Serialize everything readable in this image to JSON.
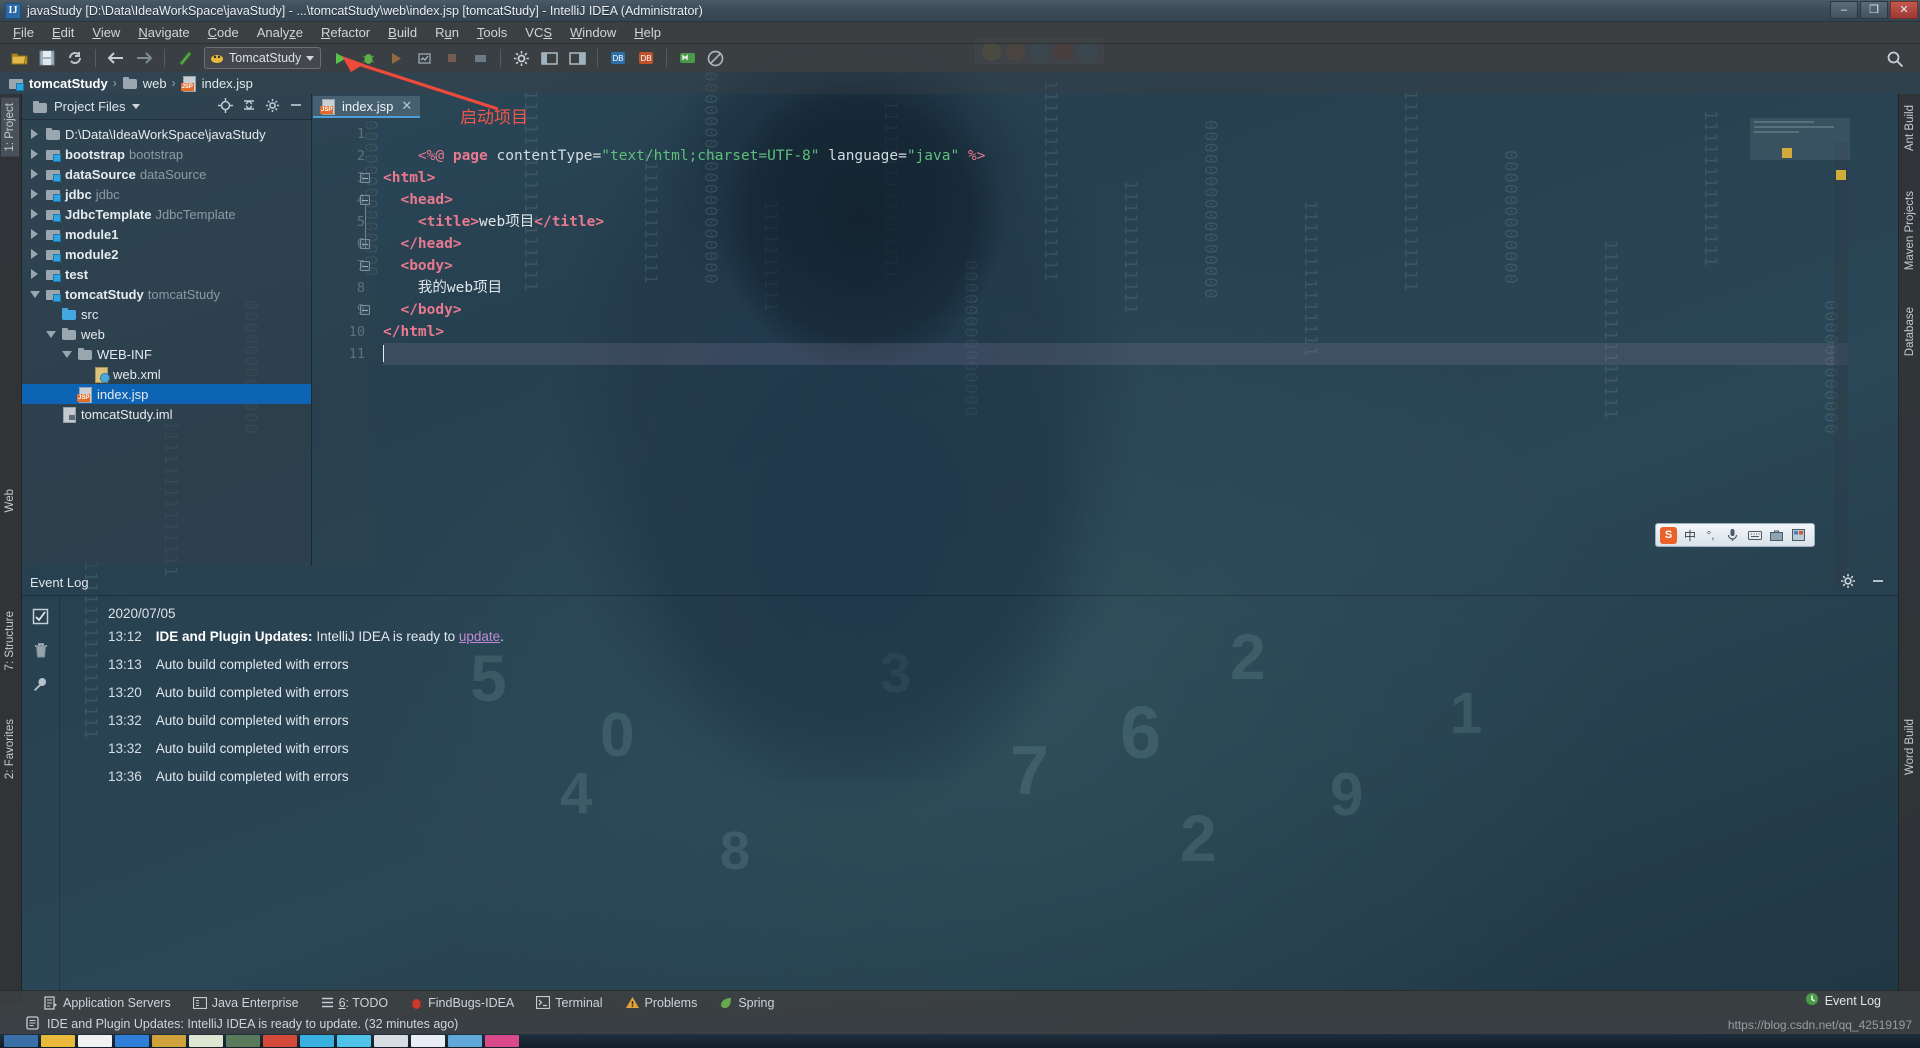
{
  "window": {
    "title": "javaStudy [D:\\Data\\IdeaWorkSpace\\javaStudy] - ...\\tomcatStudy\\web\\index.jsp [tomcatStudy] - IntelliJ IDEA (Administrator)",
    "app_icon": "IJ",
    "minimize_label": "–",
    "maximize_label": "❐",
    "close_label": "✕"
  },
  "menubar": {
    "items": [
      {
        "label": "File",
        "mnemonic": "F"
      },
      {
        "label": "Edit",
        "mnemonic": "E"
      },
      {
        "label": "View",
        "mnemonic": "V"
      },
      {
        "label": "Navigate",
        "mnemonic": "N"
      },
      {
        "label": "Code",
        "mnemonic": "C"
      },
      {
        "label": "Analyze",
        "mnemonic": "z"
      },
      {
        "label": "Refactor",
        "mnemonic": "R"
      },
      {
        "label": "Build",
        "mnemonic": "B"
      },
      {
        "label": "Run",
        "mnemonic": "u"
      },
      {
        "label": "Tools",
        "mnemonic": "T"
      },
      {
        "label": "VCS",
        "mnemonic": "S"
      },
      {
        "label": "Window",
        "mnemonic": "W"
      },
      {
        "label": "Help",
        "mnemonic": "H"
      }
    ]
  },
  "toolbar": {
    "open_icon": "open-folder-icon",
    "save_icon": "save-icon",
    "sync_icon": "sync-icon",
    "back_icon": "back-arrow-icon",
    "forward_icon": "forward-arrow-icon",
    "compile_icon": "compile-icon",
    "run_config_name": "TomcatStudy",
    "run_icon": "run-icon",
    "debug_icon": "debug-icon",
    "coverage_icon": "run-with-coverage-icon",
    "profile_icon": "profile-icon",
    "stop_icon": "stop-icon",
    "update_app_icon": "update-application-icon",
    "settings_icon": "settings-gear-icon",
    "project-structure_icon": "project-structure-icon",
    "modules_icon": "modules-icon",
    "db_icon": "database-icon",
    "db2_icon": "database-sync-icon",
    "search_everywhere_icon": "search-icon"
  },
  "navbar": {
    "crumbs": [
      {
        "label": "tomcatStudy",
        "icon": "module-icon",
        "bold": true
      },
      {
        "label": "web",
        "icon": "folder-icon",
        "bold": false
      },
      {
        "label": "index.jsp",
        "icon": "jsp-file-icon",
        "bold": false
      }
    ],
    "separator": "›"
  },
  "left_strip": {
    "tabs": [
      {
        "label": "1: Project",
        "active": true
      },
      {
        "label": "Web",
        "active": false
      },
      {
        "label": "7: Structure",
        "active": false
      },
      {
        "label": "2: Favorites",
        "active": false
      }
    ]
  },
  "right_strip": {
    "tabs": [
      {
        "label": "Ant Build"
      },
      {
        "label": "Maven Projects"
      },
      {
        "label": "Database"
      },
      {
        "label": "Word Build"
      }
    ]
  },
  "project_panel": {
    "title": "Project Files",
    "dropdown_icon": "chevron-down-icon",
    "actions": [
      {
        "name": "locate-icon",
        "glyph": "⊕"
      },
      {
        "name": "collapse-all-icon",
        "glyph": "↥"
      },
      {
        "name": "settings-gear-icon",
        "glyph": "⚙"
      },
      {
        "name": "hide-panel-icon",
        "glyph": "—"
      }
    ],
    "tree": [
      {
        "label": "D:\\Data\\IdeaWorkSpace\\javaStudy",
        "sub": "",
        "indent": 0,
        "twisty": "right",
        "icon": "folder",
        "bold": false,
        "selected": false
      },
      {
        "label": "bootstrap",
        "sub": "bootstrap",
        "indent": 0,
        "twisty": "right",
        "icon": "module",
        "bold": true,
        "selected": false
      },
      {
        "label": "dataSource",
        "sub": "dataSource",
        "indent": 0,
        "twisty": "right",
        "icon": "module",
        "bold": true,
        "selected": false
      },
      {
        "label": "jdbc",
        "sub": "jdbc",
        "indent": 0,
        "twisty": "right",
        "icon": "module",
        "bold": true,
        "selected": false
      },
      {
        "label": "JdbcTemplate",
        "sub": "JdbcTemplate",
        "indent": 0,
        "twisty": "right",
        "icon": "module",
        "bold": true,
        "selected": false
      },
      {
        "label": "module1",
        "sub": "",
        "indent": 0,
        "twisty": "right",
        "icon": "module",
        "bold": true,
        "selected": false
      },
      {
        "label": "module2",
        "sub": "",
        "indent": 0,
        "twisty": "right",
        "icon": "module",
        "bold": true,
        "selected": false
      },
      {
        "label": "test",
        "sub": "",
        "indent": 0,
        "twisty": "right",
        "icon": "module",
        "bold": true,
        "selected": false
      },
      {
        "label": "tomcatStudy",
        "sub": "tomcatStudy",
        "indent": 0,
        "twisty": "down",
        "icon": "module",
        "bold": true,
        "selected": false
      },
      {
        "label": "src",
        "sub": "",
        "indent": 1,
        "twisty": "none",
        "icon": "folder-blue",
        "bold": false,
        "selected": false
      },
      {
        "label": "web",
        "sub": "",
        "indent": 1,
        "twisty": "down",
        "icon": "folder",
        "bold": false,
        "selected": false
      },
      {
        "label": "WEB-INF",
        "sub": "",
        "indent": 2,
        "twisty": "down",
        "icon": "folder",
        "bold": false,
        "selected": false
      },
      {
        "label": "web.xml",
        "sub": "",
        "indent": 3,
        "twisty": "none",
        "icon": "xml",
        "bold": false,
        "selected": false
      },
      {
        "label": "index.jsp",
        "sub": "",
        "indent": 2,
        "twisty": "none",
        "icon": "jsp",
        "bold": false,
        "selected": true
      },
      {
        "label": "tomcatStudy.iml",
        "sub": "",
        "indent": 1,
        "twisty": "none",
        "icon": "iml",
        "bold": false,
        "selected": false
      }
    ]
  },
  "editor": {
    "tab": {
      "label": "index.jsp",
      "icon": "jsp-file-icon",
      "close_glyph": "✕"
    },
    "lines": [
      {
        "num": "1",
        "segments": [],
        "current": false
      },
      {
        "num": "2",
        "segments": [
          {
            "t": "    ",
            "c": "k-plain"
          },
          {
            "t": "<%@ ",
            "c": "k-dir"
          },
          {
            "t": "page",
            "c": "k-bold"
          },
          {
            "t": " contentType=",
            "c": "k-attr"
          },
          {
            "t": "\"text/html;charset=UTF-8\"",
            "c": "k-str"
          },
          {
            "t": " language=",
            "c": "k-attr"
          },
          {
            "t": "\"java\"",
            "c": "k-str"
          },
          {
            "t": " %>",
            "c": "k-dir"
          }
        ],
        "current": false
      },
      {
        "num": "3",
        "segments": [
          {
            "t": "<html>",
            "c": "k-tag"
          }
        ],
        "current": false
      },
      {
        "num": "4",
        "segments": [
          {
            "t": "  ",
            "c": "k-plain"
          },
          {
            "t": "<head>",
            "c": "k-tag"
          }
        ],
        "current": false
      },
      {
        "num": "5",
        "segments": [
          {
            "t": "    ",
            "c": "k-plain"
          },
          {
            "t": "<title>",
            "c": "k-tag"
          },
          {
            "t": "web项目",
            "c": "k-txt"
          },
          {
            "t": "</title>",
            "c": "k-tag"
          }
        ],
        "current": false
      },
      {
        "num": "6",
        "segments": [
          {
            "t": "  ",
            "c": "k-plain"
          },
          {
            "t": "</head>",
            "c": "k-tag"
          }
        ],
        "current": false
      },
      {
        "num": "7",
        "segments": [
          {
            "t": "  ",
            "c": "k-plain"
          },
          {
            "t": "<body>",
            "c": "k-tag"
          }
        ],
        "current": false
      },
      {
        "num": "8",
        "segments": [
          {
            "t": "    ",
            "c": "k-plain"
          },
          {
            "t": "我的web项目",
            "c": "k-txt"
          }
        ],
        "current": false
      },
      {
        "num": "9",
        "segments": [
          {
            "t": "  ",
            "c": "k-plain"
          },
          {
            "t": "</body>",
            "c": "k-tag"
          }
        ],
        "current": false
      },
      {
        "num": "10",
        "segments": [
          {
            "t": "</html>",
            "c": "k-tag"
          }
        ],
        "current": false
      },
      {
        "num": "11",
        "segments": [],
        "current": true,
        "caret": true
      }
    ]
  },
  "annotation": {
    "text": "启动项目",
    "color": "#f0564a",
    "arrow_name": "red-annotation-arrow"
  },
  "browser_popup": {
    "browsers": [
      {
        "name": "chrome-icon",
        "color": "#f2c14b"
      },
      {
        "name": "firefox-icon",
        "color": "#f08a24"
      },
      {
        "name": "edge-legacy-icon",
        "color": "#2e9fe0"
      },
      {
        "name": "opera-icon",
        "color": "#e0352b"
      },
      {
        "name": "ie-icon",
        "color": "#2e9fe0"
      }
    ]
  },
  "event_log": {
    "title": "Event Log",
    "actions": [
      {
        "name": "settings-gear-icon",
        "glyph": "⚙"
      },
      {
        "name": "hide-panel-icon",
        "glyph": "—"
      }
    ],
    "gutter_icons": [
      {
        "name": "mark-all-read-icon",
        "glyph": "☑"
      },
      {
        "name": "clear-all-icon",
        "glyph": "🗑"
      },
      {
        "name": "configure-notifications-icon",
        "glyph": "🔧"
      }
    ],
    "date": "2020/07/05",
    "entries": [
      {
        "time": "13:12",
        "bold": "IDE and Plugin Updates:",
        "text": " IntelliJ IDEA is ready to ",
        "link": "update",
        "tail": "."
      },
      {
        "time": "13:13",
        "bold": "",
        "text": "Auto build completed with errors",
        "link": "",
        "tail": ""
      },
      {
        "time": "13:20",
        "bold": "",
        "text": "Auto build completed with errors",
        "link": "",
        "tail": ""
      },
      {
        "time": "13:32",
        "bold": "",
        "text": "Auto build completed with errors",
        "link": "",
        "tail": ""
      },
      {
        "time": "13:32",
        "bold": "",
        "text": "Auto build completed with errors",
        "link": "",
        "tail": ""
      },
      {
        "time": "13:36",
        "bold": "",
        "text": "Auto build completed with errors",
        "link": "",
        "tail": ""
      }
    ]
  },
  "bottom_bar": {
    "buttons": [
      {
        "label": "Application Servers",
        "icon": "application-servers-icon",
        "mnemonic": ""
      },
      {
        "label": "Java Enterprise",
        "icon": "java-enterprise-icon",
        "mnemonic": ""
      },
      {
        "label": "6: TODO",
        "icon": "todo-icon",
        "mnemonic": "6"
      },
      {
        "label": "FindBugs-IDEA",
        "icon": "findbugs-icon",
        "mnemonic": ""
      },
      {
        "label": "Terminal",
        "icon": "terminal-icon",
        "mnemonic": ""
      },
      {
        "label": "Problems",
        "icon": "problems-warning-icon",
        "mnemonic": ""
      },
      {
        "label": "Spring",
        "icon": "spring-leaf-icon",
        "mnemonic": ""
      }
    ],
    "event_log_button": {
      "label": "Event Log",
      "icon": "event-log-icon"
    }
  },
  "status_bar": {
    "icon": "notification-icon",
    "message": "IDE and Plugin Updates: IntelliJ IDEA is ready to update. (32 minutes ago)"
  },
  "watermark": {
    "text": "https://blog.csdn.net/qq_42519197"
  },
  "ime_bar": {
    "logo": "S",
    "mode_label": "中",
    "items": [
      {
        "name": "punctuation-icon",
        "glyph": "°,"
      },
      {
        "name": "microphone-icon",
        "glyph": "⌇"
      },
      {
        "name": "keyboard-icon",
        "glyph": "⌨"
      },
      {
        "name": "toolbox-icon",
        "glyph": "⚒"
      },
      {
        "name": "skin-icon",
        "glyph": "▦"
      }
    ]
  },
  "taskbar": {
    "items": [
      {
        "name": "start-orb",
        "color": "#3a6fa8"
      },
      {
        "name": "app-1",
        "color": "#e8b93a"
      },
      {
        "name": "app-2",
        "color": "#f2f2f2"
      },
      {
        "name": "app-3",
        "color": "#2f7fd8"
      },
      {
        "name": "app-4",
        "color": "#cfa23a"
      },
      {
        "name": "app-5",
        "color": "#dde6d0"
      },
      {
        "name": "app-6",
        "color": "#5b7a5b"
      },
      {
        "name": "app-7",
        "color": "#d44a3a"
      },
      {
        "name": "app-8",
        "color": "#3ab0e0"
      },
      {
        "name": "app-9",
        "color": "#4fc3e8"
      },
      {
        "name": "app-10",
        "color": "#d8dde2"
      },
      {
        "name": "app-11",
        "color": "#e8eef3"
      },
      {
        "name": "app-12",
        "color": "#5fa8d8"
      },
      {
        "name": "app-13",
        "color": "#d84a8a"
      }
    ]
  },
  "colors": {
    "accent_blue": "#0d64b5",
    "tab_underline": "#4f9fd6",
    "annotation_red": "#f0564a",
    "string_green": "#5fbf7d",
    "tag_pink": "#e8798f",
    "link_purple": "#c08cd8"
  }
}
